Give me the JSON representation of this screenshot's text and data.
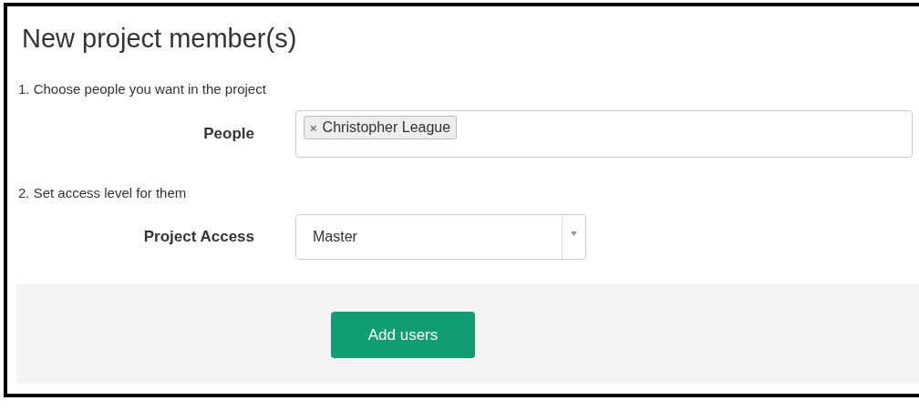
{
  "title": "New project member(s)",
  "steps": [
    {
      "text": "1. Choose people you want in the project",
      "field": {
        "kind": "tags",
        "label": "People",
        "tags": [
          {
            "remove": "×",
            "text": "Christopher League"
          }
        ]
      }
    },
    {
      "text": "2. Set access level for them",
      "field": {
        "kind": "select",
        "label": "Project Access",
        "value": "Master"
      }
    }
  ],
  "submit": {
    "label": "Add users"
  }
}
